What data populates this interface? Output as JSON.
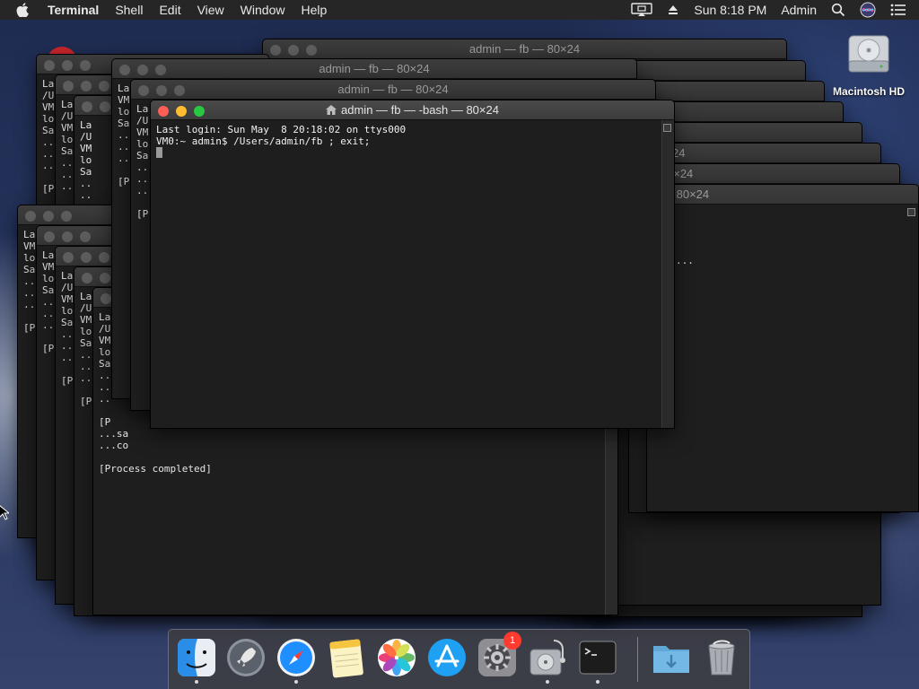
{
  "menubar": {
    "app_name": "Terminal",
    "menus": [
      "Shell",
      "Edit",
      "View",
      "Window",
      "Help"
    ],
    "clock": "Sun 8:18 PM",
    "user": "Admin"
  },
  "desktop": {
    "disk_label": "Macintosh HD"
  },
  "windows": {
    "back_title": "admin — fb — 80×24",
    "title_partial": "— 80×24",
    "title_frag_a": "24",
    "title_frag_b": "0×24",
    "title_frag_c": "— 80×24",
    "ellipsis": "...",
    "frag_lines": {
      "a": "La\n/U\nVM\nlo\nSa\n..\n..\n..\n\n[P",
      "b": "La\nVM\nlo\nSa\n..\n..\n..\n\n[P",
      "c": "La\n/U\nVM\nlo\nSa\n..\n..\n..\n\n[P",
      "d": "La\n/U\nVM\nlo\nSa\n..\n..\n..\n\n[P",
      "e": "La\nVM\nlo\nSa\n..\n..\n..\n\n[P"
    },
    "lower_lines": [
      "...sa",
      "...co",
      "",
      "[Process completed]"
    ]
  },
  "terminal": {
    "title": "admin — fb — -bash — 80×24",
    "lines": [
      "Last login: Sun May  8 20:18:02 on ttys000",
      "VM0:~ admin$ /Users/admin/fb ; exit;"
    ]
  },
  "dock": {
    "items": [
      "finder",
      "launchpad",
      "safari",
      "notes",
      "photos",
      "app-store",
      "system-preferences",
      "disk-utility",
      "terminal",
      "downloads",
      "trash"
    ],
    "system_preferences_badge": "1"
  }
}
